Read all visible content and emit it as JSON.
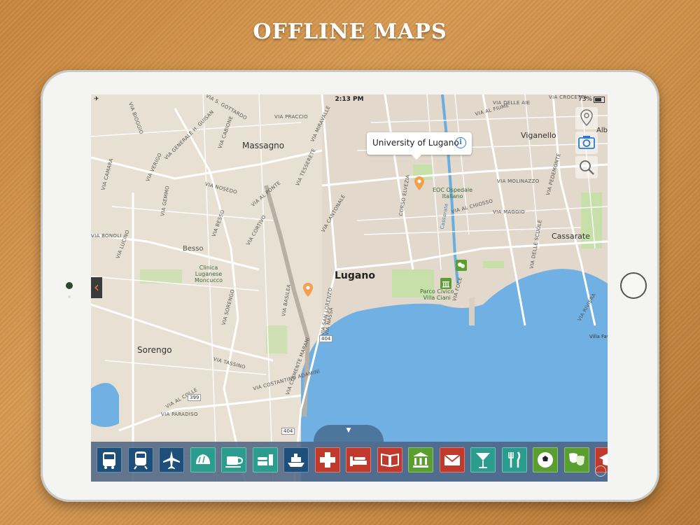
{
  "headline": "OFFLINE MAPS",
  "status_bar": {
    "left": "✈",
    "time": "2:13 PM",
    "battery": "73%"
  },
  "callout": {
    "title": "University of Lugano"
  },
  "places": {
    "massagno": "Massagno",
    "lugano": "Lugano",
    "besso": "Besso",
    "sorengo": "Sorengo",
    "viganello": "Viganello",
    "cassarate": "Cassarate",
    "clinica": "Clinica\nLuganese\nMoncucco",
    "parco": "Parco Civico\nVilla Ciani",
    "eoc": "EOC Ospedale\nItaliano",
    "alb": "Alb",
    "villa_fav": "Villa Fav"
  },
  "streets": {
    "gottardo": "VIA S. GOTTARDO",
    "biogio": "VIA BIOGGIO",
    "guisan": "VIA GENERALE H. GUISAN",
    "cabione": "VIA CABIONE",
    "praccio": "VIA PRACCIO",
    "ai_mirante": "VIA MIRAVALLE",
    "tesserete": "VIA TESSERETE",
    "delle_aie": "VIA DELLE AIE",
    "al_fiume": "VIA AL FIUME",
    "crocetta": "VIA CROCETTA",
    "nosedo": "VIA NOSEDO",
    "al_ponte": "VIA AL PONTE",
    "besso": "VIA BESSO",
    "cortivo": "VIA CORTIVO",
    "cantonale": "VIA CANTONALE",
    "elvezia": "CORSO ELVEZIA",
    "molinazzo": "VIA MOLINAZZO",
    "maggio": "VIA MAGGIO",
    "al_chiosso": "VIA AL CHIOSSO",
    "sorengo": "VIA SORENGO",
    "basilea": "VIA BASILEA",
    "san_lorenzo": "VIA SAN LORENZO",
    "nassa": "VIA NASSA",
    "marani": "VIA CLEMENTE MARANI",
    "adamini": "VIA COSTANTINO ADAMINI",
    "tassino": "VIA TASSINO",
    "paradiso": "VIA PARADISO",
    "al_colle": "VIA AL COLLE",
    "riviera": "VIA RIVIERA",
    "foce": "VIA FOCE",
    "cassarate": "Cassarate",
    "bonoli": "VIA BONOLI",
    "lucino": "VIA LUCINO",
    "camara": "VIA CAMARA",
    "verigo": "VIA VERIGO",
    "gemmo": "VIA GEMMO",
    "pedemonte": "VIA PEDEMONTE",
    "delle_scuole": "VIA DELLE SCUOLE"
  },
  "road_numbers": {
    "r404a": "404",
    "r404b": "404",
    "r399": "399"
  },
  "dock": [
    {
      "name": "bus-icon",
      "color": "#1d4f7a"
    },
    {
      "name": "train-icon",
      "color": "#1d4f7a"
    },
    {
      "name": "airplane-icon",
      "color": "#1d4f7a"
    },
    {
      "name": "bread-icon",
      "color": "#2a9d8f"
    },
    {
      "name": "coffee-icon",
      "color": "#2a9d8f"
    },
    {
      "name": "fastfood-icon",
      "color": "#2a9d8f"
    },
    {
      "name": "ferry-icon",
      "color": "#1d4f7a"
    },
    {
      "name": "hospital-icon",
      "color": "#c0392b"
    },
    {
      "name": "hotel-icon",
      "color": "#c0392b"
    },
    {
      "name": "book-icon",
      "color": "#c0392b"
    },
    {
      "name": "museum-icon",
      "color": "#5a9e2f"
    },
    {
      "name": "mail-icon",
      "color": "#c0392b"
    },
    {
      "name": "cocktail-icon",
      "color": "#2a9d8f"
    },
    {
      "name": "restaurant-icon",
      "color": "#2a9d8f"
    },
    {
      "name": "football-icon",
      "color": "#5a9e2f"
    },
    {
      "name": "theatre-icon",
      "color": "#5a9e2f"
    },
    {
      "name": "education-icon",
      "color": "#c0392b"
    }
  ]
}
